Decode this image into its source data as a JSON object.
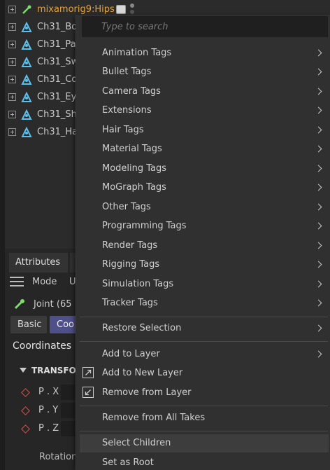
{
  "objects": {
    "items": [
      {
        "name": "mixamorig9:Hips"
      },
      {
        "name": "Ch31_Bo"
      },
      {
        "name": "Ch31_Pa"
      },
      {
        "name": "Ch31_Sw"
      },
      {
        "name": "Ch31_Co"
      },
      {
        "name": "Ch31_Ey"
      },
      {
        "name": "Ch31_Sh"
      },
      {
        "name": "Ch31_Ha"
      }
    ]
  },
  "attributes": {
    "tab_label": "Attributes",
    "mode_label": "Mode",
    "mode_extra": "U",
    "object_label": "Joint (65",
    "tabs": [
      "Basic",
      "Coo"
    ],
    "section_title": "Coordinates",
    "transform_label": "TRANSFO",
    "params": [
      "P . X",
      "P . Y",
      "P . Z"
    ],
    "rotation_label": "Rotation"
  },
  "menu": {
    "search_placeholder": "Type to search",
    "items": [
      {
        "label": "Animation Tags",
        "submenu": true
      },
      {
        "label": "Bullet Tags",
        "submenu": true
      },
      {
        "label": "Camera Tags",
        "submenu": true
      },
      {
        "label": "Extensions",
        "submenu": true
      },
      {
        "label": "Hair Tags",
        "submenu": true
      },
      {
        "label": "Material Tags",
        "submenu": true
      },
      {
        "label": "Modeling Tags",
        "submenu": true
      },
      {
        "label": "MoGraph Tags",
        "submenu": true
      },
      {
        "label": "Other Tags",
        "submenu": true
      },
      {
        "label": "Programming Tags",
        "submenu": true
      },
      {
        "label": "Render Tags",
        "submenu": true
      },
      {
        "label": "Rigging Tags",
        "submenu": true
      },
      {
        "label": "Simulation Tags",
        "submenu": true
      },
      {
        "label": "Tracker Tags",
        "submenu": true
      },
      {
        "label": "Restore Selection",
        "submenu": true
      },
      {
        "label": "Add to Layer",
        "submenu": true
      },
      {
        "label": "Add to New Layer",
        "submenu": false
      },
      {
        "label": "Remove from Layer",
        "submenu": false
      },
      {
        "label": "Remove from All Takes",
        "submenu": false
      },
      {
        "label": "Select Children",
        "submenu": false,
        "highlighted": true
      },
      {
        "label": "Set as Root",
        "submenu": false
      }
    ]
  },
  "colors": {
    "accent_orange": "#e7a240",
    "joint_icon": "#5bc0eb",
    "tab_active": "#4f4f8a",
    "param_diamond": "#d0554e"
  }
}
